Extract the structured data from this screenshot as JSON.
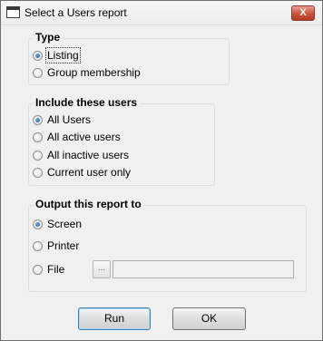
{
  "window": {
    "title": "Select a Users report",
    "close_label": "X"
  },
  "type_group": {
    "title": "Type",
    "options": [
      {
        "label": "Listing",
        "checked": true
      },
      {
        "label": "Group membership",
        "checked": false
      }
    ]
  },
  "users_group": {
    "title": "Include these users",
    "options": [
      {
        "label": "All Users",
        "checked": true
      },
      {
        "label": "All active users",
        "checked": false
      },
      {
        "label": "All inactive users",
        "checked": false
      },
      {
        "label": "Current user only",
        "checked": false
      }
    ]
  },
  "output_group": {
    "title": "Output this report to",
    "options": [
      {
        "label": "Screen",
        "checked": true
      },
      {
        "label": "Printer",
        "checked": false
      },
      {
        "label": "File",
        "checked": false
      }
    ],
    "browse_label": "...",
    "file_path": ""
  },
  "buttons": {
    "run": "Run",
    "ok": "OK"
  }
}
